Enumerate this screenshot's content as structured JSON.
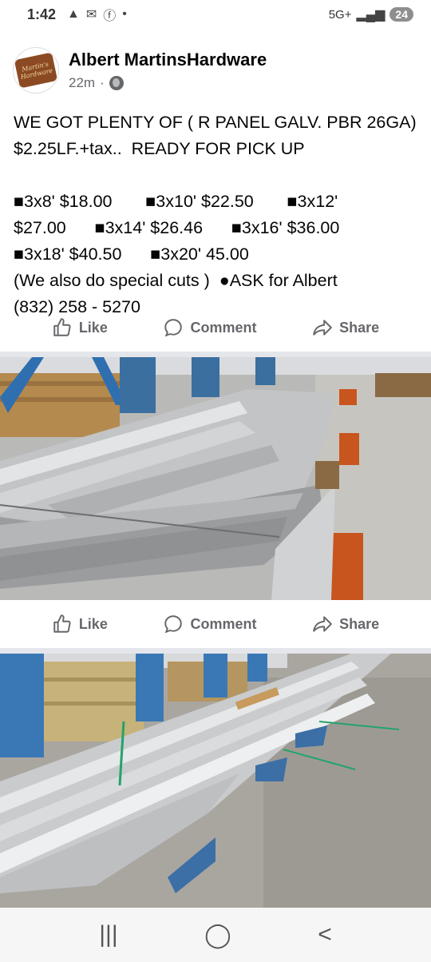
{
  "status_bar": {
    "time": "1:42",
    "network": "5G+",
    "battery": "24",
    "icons": [
      "alert-icon",
      "mail-icon",
      "facebook-icon",
      "dot-icon"
    ]
  },
  "post": {
    "author": "Albert MartinsHardware",
    "avatar_text": "Martin's Hardware",
    "time": "22m",
    "visibility_icon": "globe-icon",
    "headline": "WE GOT PLENTY OF ( R PANEL GALV. PBR 26GA) $2.25LF.+tax..  READY FOR PICK UP",
    "prices": [
      "■3x8' $18.00       ■3x10' $22.50       ■3x12'",
      "$27.00      ■3x14' $26.46      ■3x16' $36.00",
      "■3x18' $40.50      ■3x20' 45.00"
    ],
    "footer_line1": "(We also do special cuts )  ●ASK for Albert",
    "footer_line2": "(832) 258 - 5270"
  },
  "actions": {
    "like": "Like",
    "comment": "Comment",
    "share": "Share"
  },
  "nav": {
    "recents": "|||",
    "home": "◯",
    "back": "<"
  }
}
